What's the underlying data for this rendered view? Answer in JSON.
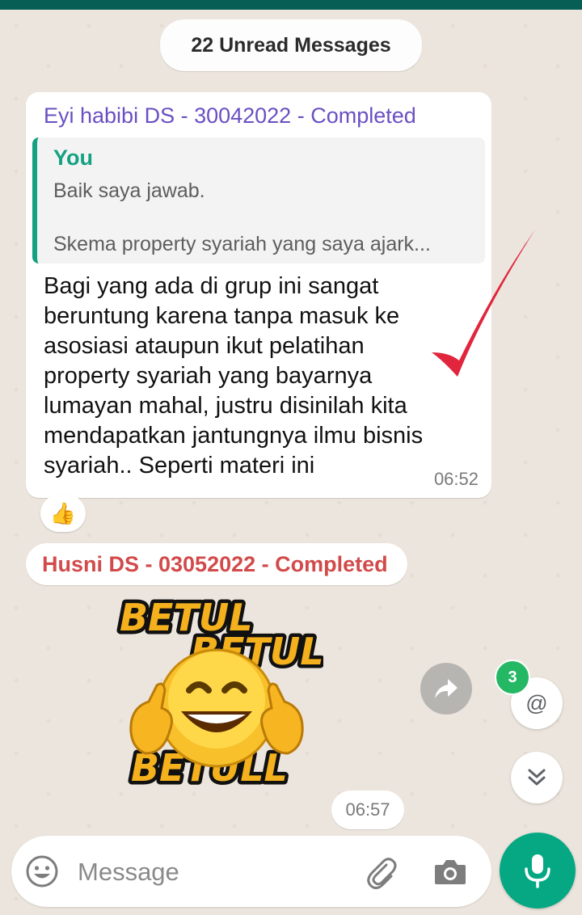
{
  "unread_banner": {
    "text": "22 Unread Messages"
  },
  "message1": {
    "sender": "Eyi habibi DS - 30042022 - Completed",
    "quoted": {
      "author": "You",
      "line1": "Baik saya jawab.",
      "line2": "Skema property syariah yang saya ajark..."
    },
    "text": "Bagi yang ada di grup ini sangat\nberuntung karena tanpa masuk ke\nasosiasi ataupun ikut pelatihan\nproperty syariah yang bayarnya\nlumayan mahal, justru disinilah kita\nmendapatkan jantungnya ilmu bisnis\nsyariah.. Seperti materi ini",
    "time": "06:52",
    "reaction": "👍"
  },
  "message2": {
    "sender": "Husni DS - 03052022 - Completed",
    "sticker_words": [
      "BETUL",
      "BETUL",
      "BETULL"
    ],
    "time": "06:57"
  },
  "mention": {
    "symbol": "@",
    "count": "3"
  },
  "composer": {
    "placeholder": "Message"
  },
  "icons": {
    "forward": "forward-icon",
    "scroll_down": "double-chevron-down-icon",
    "emoji": "emoji-icon",
    "attach": "paperclip-icon",
    "camera": "camera-icon",
    "mic": "microphone-icon"
  },
  "colors": {
    "header": "#075e54",
    "accent_green": "#06a884",
    "sender1": "#6a4fc2",
    "sender2": "#d24a4a",
    "quote_author": "#14a182",
    "badge": "#25b864"
  }
}
